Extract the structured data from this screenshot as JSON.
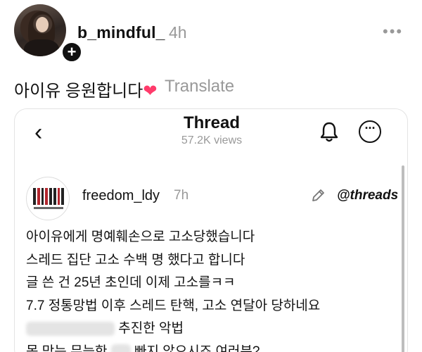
{
  "post": {
    "username": "b_mindful_",
    "time": "4h",
    "more_icon": "more-horizontal-icon",
    "caption": "아이유 응원합니다",
    "caption_emoji": "❤",
    "translate_label": "Translate",
    "follow_glyph": "+"
  },
  "embedded": {
    "title": "Thread",
    "views": "57.2K views",
    "back_glyph": "‹",
    "menu_glyph": "···",
    "inner_post": {
      "username": "freedom_ldy",
      "time": "7h",
      "brand": "@threads",
      "lines": [
        "아이유에게 명예훼손으로 고소당했습니다",
        "스레드 집단 고소 수백 명 했다고 합니다",
        "글 쓴 건 25년 초인데 이제 고소를ㅋㅋ",
        "7.7 정통망법 이후 스레드 탄핵, 고소 연달아 당하네요",
        "추진한 악법",
        "못 막는 무능한",
        "빠지 않으시죠 여러분?"
      ]
    }
  },
  "colors": {
    "accent_heart": "#ff3b6b",
    "muted": "#999999"
  }
}
